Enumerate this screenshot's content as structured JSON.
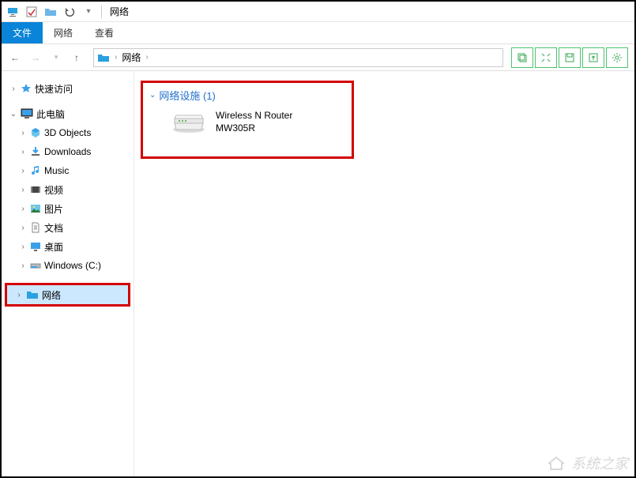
{
  "titlebar": {
    "window_title": "网络"
  },
  "ribbon": {
    "tabs": [
      "文件",
      "网络",
      "查看"
    ],
    "active_index": 0
  },
  "nav": {
    "back_label": "←",
    "forward_label": "→",
    "up_label": "↑"
  },
  "addressbar": {
    "crumbs": [
      "网络"
    ]
  },
  "sidebar": {
    "quick_access": "快速访问",
    "this_pc": "此电脑",
    "children": [
      {
        "label": "3D Objects",
        "icon": "cube"
      },
      {
        "label": "Downloads",
        "icon": "download"
      },
      {
        "label": "Music",
        "icon": "music"
      },
      {
        "label": "视频",
        "icon": "video"
      },
      {
        "label": "图片",
        "icon": "image"
      },
      {
        "label": "文档",
        "icon": "document"
      },
      {
        "label": "桌面",
        "icon": "desktop"
      },
      {
        "label": "Windows (C:)",
        "icon": "drive"
      }
    ],
    "network": "网络"
  },
  "content": {
    "group_title": "网络设施 (1)",
    "device_line1": "Wireless N Router",
    "device_line2": "MW305R"
  },
  "watermark": "系统之家"
}
